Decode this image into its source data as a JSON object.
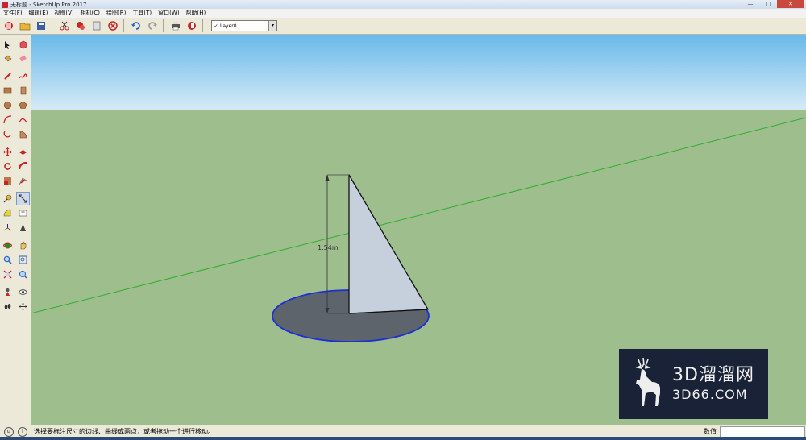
{
  "window": {
    "title": "无标题 - SketchUp Pro 2017",
    "buttons": {
      "minimize": "—",
      "maximize": "□",
      "close": "✕"
    }
  },
  "menu": [
    "文件(F)",
    "编辑(E)",
    "视图(V)",
    "相机(C)",
    "绘图(R)",
    "工具(T)",
    "窗口(W)",
    "帮助(H)"
  ],
  "toolbar": {
    "layer": {
      "check": "✓",
      "value": "Layer0",
      "arrow": "▾"
    }
  },
  "viewport": {
    "dimension_label": "1.54m",
    "colors": {
      "sky_top": "#68b9ea",
      "sky_bottom": "#d6eaf6",
      "ground": "#9ebe8e",
      "axis_green": "#2fae2f",
      "face_front": "#c5d0dc",
      "face_back": "#5d646c",
      "selection": "#1b2fd6"
    }
  },
  "watermark": {
    "cn": "3D溜溜网",
    "en": "3D66.COM"
  },
  "status": {
    "message": "选择要标注尺寸的边线、曲线或两点，或者拖动一个进行移动。",
    "value_label": "数值",
    "value": ""
  }
}
